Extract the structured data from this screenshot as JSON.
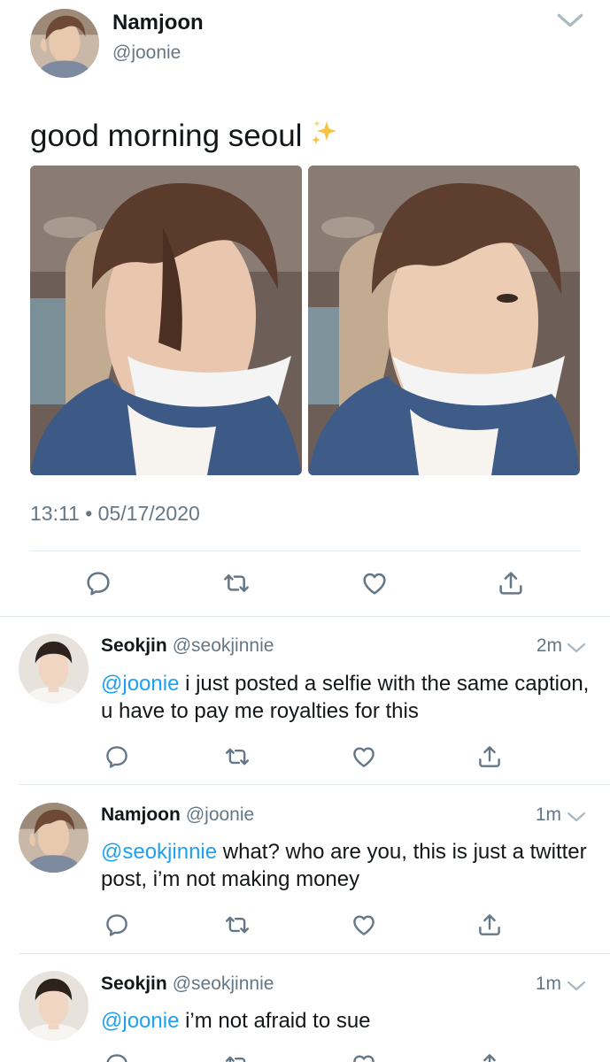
{
  "main_tweet": {
    "author_name": "Namjoon",
    "author_handle": "@joonie",
    "text": "good morning seoul",
    "emoji": "sparkles",
    "timestamp": "13:11 • 05/17/2020"
  },
  "replies": [
    {
      "author_name": "Seokjin",
      "author_handle": "@seokjinnie",
      "time": "2m",
      "mention": "@joonie",
      "text": " i just posted a selfie with the same caption, u have to pay me royalties for this"
    },
    {
      "author_name": "Namjoon",
      "author_handle": "@joonie",
      "time": "1m",
      "mention": "@seokjinnie",
      "text": " what? who are you, this is just a twitter post, i’m not making money"
    },
    {
      "author_name": "Seokjin",
      "author_handle": "@seokjinnie",
      "time": "1m",
      "mention": "@joonie",
      "text": " i’m not afraid to sue"
    }
  ],
  "icons": [
    "reply-icon",
    "retweet-icon",
    "like-icon",
    "share-icon",
    "chevron-down-icon"
  ],
  "colors": {
    "mention": "#1da1f2",
    "secondary_text": "#657786",
    "divider": "#e1e8ed",
    "icon": "#657786"
  }
}
